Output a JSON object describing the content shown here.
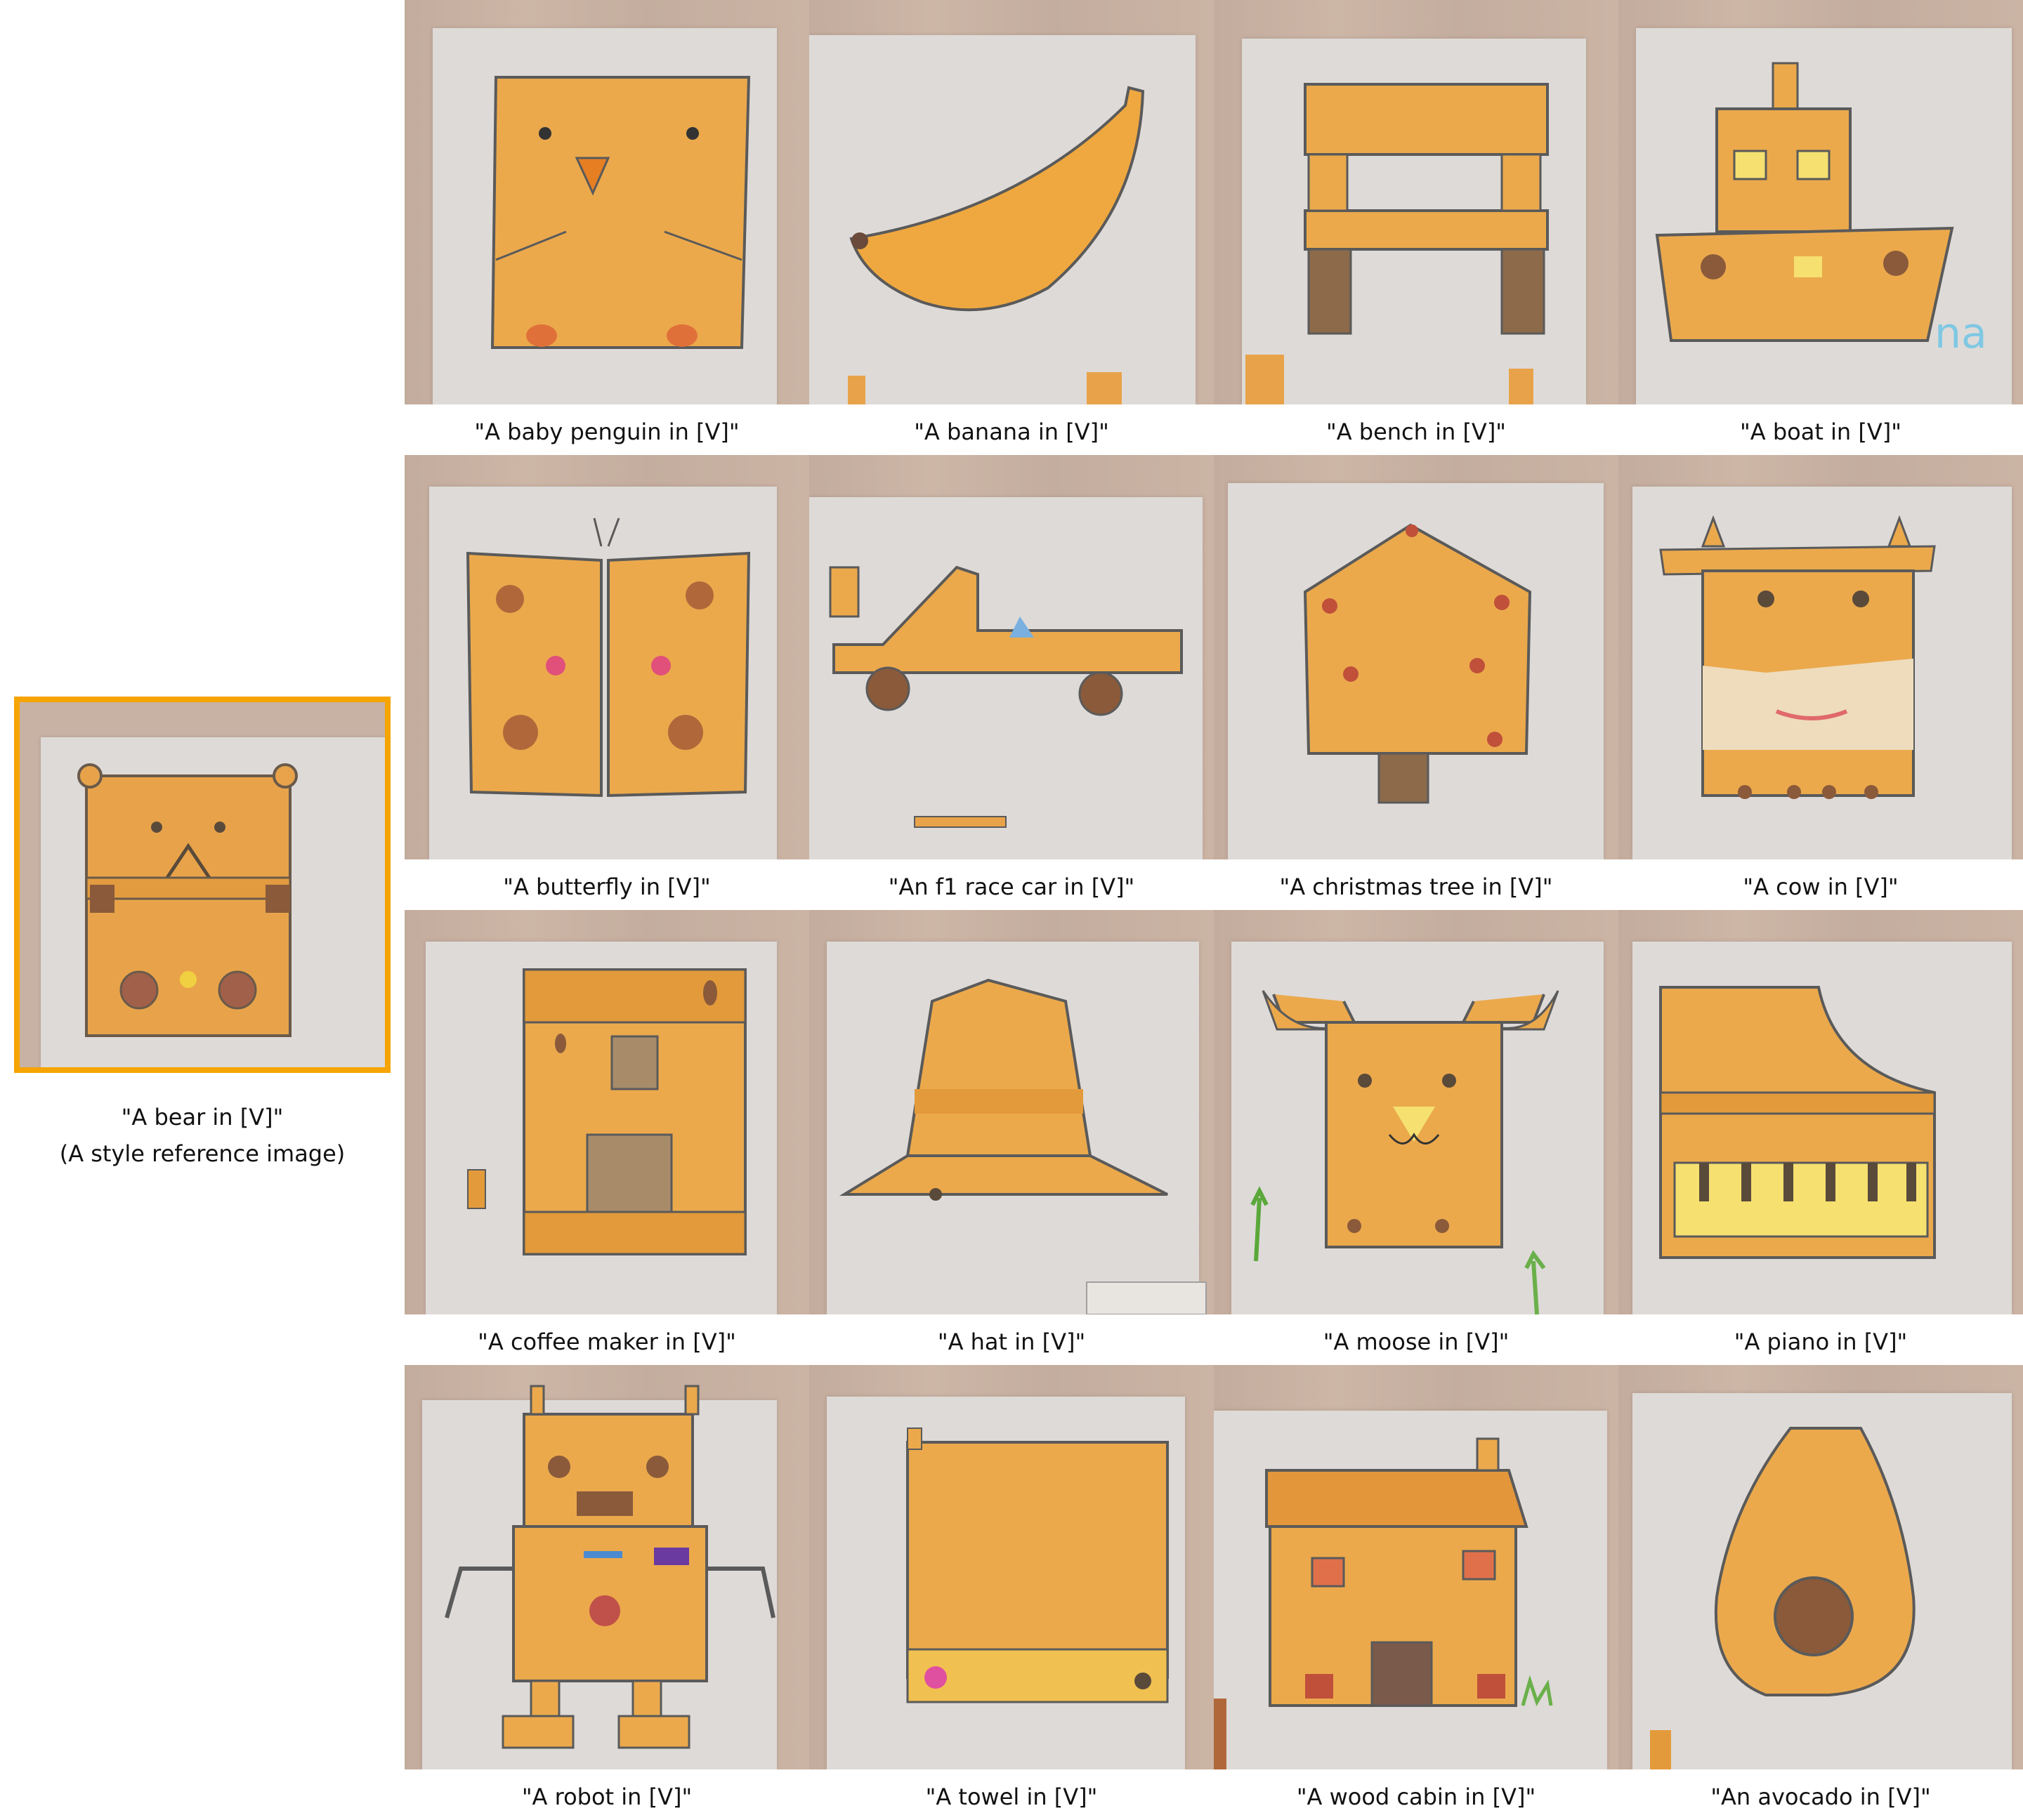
{
  "reference": {
    "caption_line1": "\"A bear in [V]\"",
    "caption_line2": "(A style reference image)",
    "accent_color": "#f5a400"
  },
  "grid": {
    "rows": [
      {
        "cells": [
          {
            "caption": "\"A baby penguin in [V]\"",
            "subject": "baby-penguin"
          },
          {
            "caption": "\"A banana in [V]\"",
            "subject": "banana"
          },
          {
            "caption": "\"A bench in [V]\"",
            "subject": "bench"
          },
          {
            "caption": "\"A boat in [V]\"",
            "subject": "boat"
          }
        ]
      },
      {
        "cells": [
          {
            "caption": "\"A butterfly in [V]\"",
            "subject": "butterfly"
          },
          {
            "caption": "\"An f1 race car in [V]\"",
            "subject": "f1-race-car"
          },
          {
            "caption": "\"A christmas tree in [V]\"",
            "subject": "christmas-tree"
          },
          {
            "caption": "\"A cow in [V]\"",
            "subject": "cow"
          }
        ]
      },
      {
        "cells": [
          {
            "caption": "\"A coffee maker in [V]\"",
            "subject": "coffee-maker"
          },
          {
            "caption": "\"A hat in [V]\"",
            "subject": "hat"
          },
          {
            "caption": "\"A moose in [V]\"",
            "subject": "moose"
          },
          {
            "caption": "\"A piano in [V]\"",
            "subject": "piano"
          }
        ]
      },
      {
        "cells": [
          {
            "caption": "\"A robot in [V]\"",
            "subject": "robot"
          },
          {
            "caption": "\"A towel in [V]\"",
            "subject": "towel"
          },
          {
            "caption": "\"A wood cabin in [V]\"",
            "subject": "wood-cabin"
          },
          {
            "caption": "\"An avocado in [V]\"",
            "subject": "avocado"
          }
        ]
      }
    ]
  },
  "drawing_watermark": "na"
}
